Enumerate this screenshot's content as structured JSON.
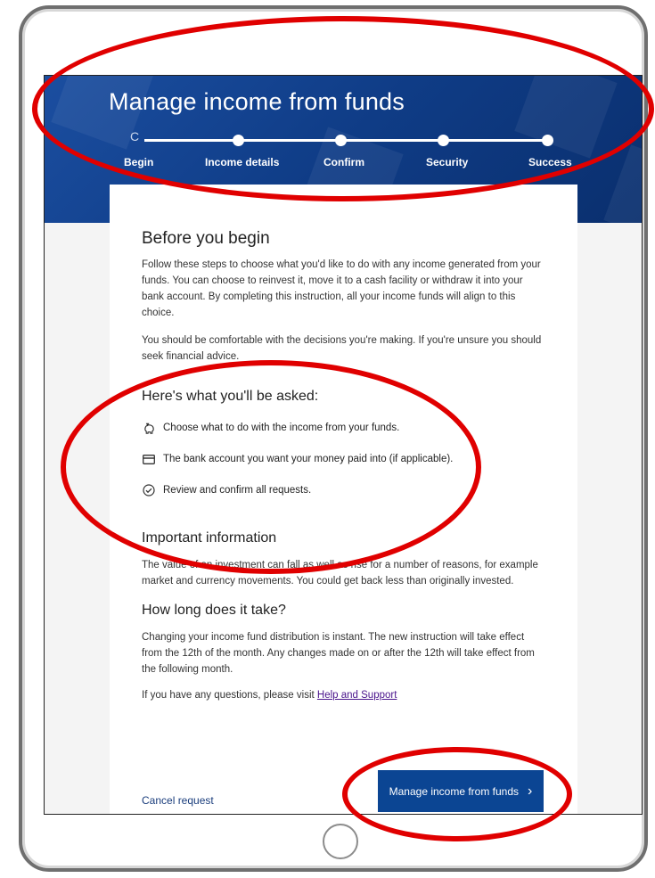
{
  "header": {
    "title": "Manage income from funds"
  },
  "stepper": {
    "begin_mark": "C",
    "steps": [
      "Begin",
      "Income details",
      "Confirm",
      "Security",
      "Success"
    ]
  },
  "before": {
    "title": "Before you begin",
    "para1": "Follow these steps to choose what you'd like to do with any income generated from your funds. You can choose to reinvest it, move it to a cash facility or withdraw it into your bank account. By completing this instruction, all your income funds will align to this choice.",
    "para2": "You should be comfortable with the decisions you're making. If you're unsure you should seek financial advice."
  },
  "asked": {
    "title": "Here's what you'll be asked:",
    "items": [
      "Choose what to do with the income from your funds.",
      "The bank account you want your money paid into (if applicable).",
      "Review and confirm all requests."
    ]
  },
  "important": {
    "title": "Important information",
    "text": "The value of an investment can fall as well as rise for a number of reasons, for example market and currency movements. You could get back less than originally invested."
  },
  "howlong": {
    "title": "How long does it take?",
    "text": "Changing your income fund distribution is instant. The new instruction will take effect from the 12th of the month. Any changes made on or after the 12th will take effect from the following month."
  },
  "help": {
    "prefix": "If you have any questions, please visit ",
    "link": "Help and Support"
  },
  "actions": {
    "primary": "Manage income from funds",
    "cancel": "Cancel request"
  },
  "colors": {
    "brand_blue": "#0b4593",
    "annotation_red": "#e00000"
  }
}
